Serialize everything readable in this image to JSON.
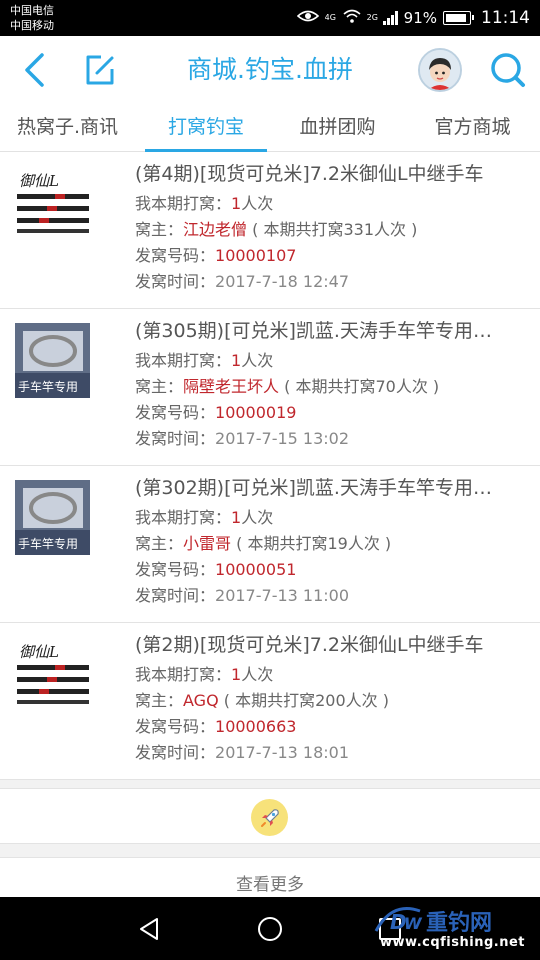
{
  "status_bar": {
    "carrier_1": "中国电信",
    "carrier_2": "中国移动",
    "net_1": "4G",
    "net_2": "2G",
    "battery_percent": "91%",
    "battery_level": 0.91,
    "time": "11:14"
  },
  "header": {
    "title": "商城.钓宝.血拼",
    "back_icon": "chevron-left-icon",
    "edit_icon": "edit-icon",
    "search_icon": "search-icon",
    "accent_color": "#2aa7e4"
  },
  "tabs": [
    {
      "label": "热窝子.商讯",
      "active": false
    },
    {
      "label": "打窝钓宝",
      "active": true
    },
    {
      "label": "血拼团购",
      "active": false
    },
    {
      "label": "官方商城",
      "active": false
    }
  ],
  "labels": {
    "my_bet_prefix": "我本期打窝：",
    "my_bet_suffix": "人次",
    "owner_prefix": "窝主：",
    "total_prefix": "( 本期共打窝",
    "total_suffix": "人次 )",
    "code_prefix": "发窝号码：",
    "time_prefix": "发窝时间："
  },
  "items": [
    {
      "title": "(第4期)[现货可兑米]7.2米御仙L中继手车",
      "my_bets": "1",
      "owner": "江边老僧",
      "total_bets": "331",
      "code": "10000107",
      "time": "2017-7-18 12:47",
      "thumb_text": "御仙L"
    },
    {
      "title": "(第305期)[可兑米]凯蓝.天涛手车竿专用…",
      "my_bets": "1",
      "owner": "隔壁老王坏人",
      "total_bets": "70",
      "code": "10000019",
      "time": "2017-7-15 13:02",
      "thumb_text": "手车竿专用"
    },
    {
      "title": "(第302期)[可兑米]凯蓝.天涛手车竿专用…",
      "my_bets": "1",
      "owner": "小雷哥",
      "total_bets": "19",
      "code": "10000051",
      "time": "2017-7-13 11:00",
      "thumb_text": "手车竿专用"
    },
    {
      "title": "(第2期)[现货可兑米]7.2米御仙L中继手车",
      "my_bets": "1",
      "owner": "AGQ",
      "total_bets": "200",
      "code": "10000663",
      "time": "2017-7-13 18:01",
      "thumb_text": "御仙L"
    }
  ],
  "footer": {
    "rocket_icon": "rocket-icon",
    "more_label": "查看更多"
  },
  "nav_bar": {
    "back_icon": "triangle-back-icon",
    "home_icon": "circle-home-icon",
    "recents_icon": "square-recents-icon"
  },
  "watermark": {
    "name": "重钓网",
    "url": "www.cqfishing.net"
  }
}
